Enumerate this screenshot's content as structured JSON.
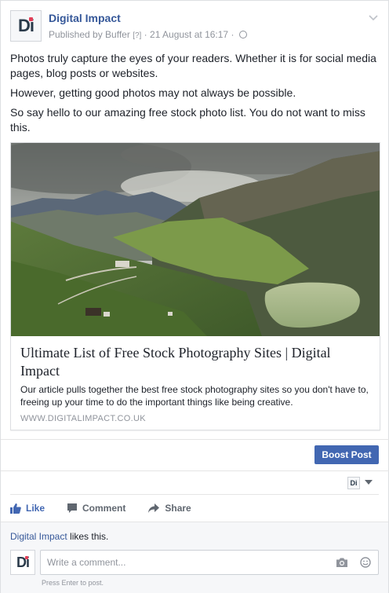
{
  "post": {
    "page_name": "Digital Impact",
    "published_by": "Published by Buffer",
    "help_marker": "[?]",
    "separator": "·",
    "timestamp": "21 August at 16:17",
    "separator2": "·",
    "avatar_text": "Di",
    "paragraphs": [
      "Photos truly capture the eyes of your readers. Whether it is for social media pages, blog posts or websites.",
      "However, getting good photos may not always be possible.",
      "So say hello to our amazing free stock photo list. You do not want to miss this."
    ]
  },
  "link_preview": {
    "title": "Ultimate List of Free Stock Photography Sites | Digital Impact",
    "description": "Our article pulls together the best free stock photography sites so you don't have to, freeing up your time to do the important things like being creative.",
    "domain": "WWW.DIGITALIMPACT.CO.UK",
    "image": "mountain-lake-landscape"
  },
  "boost_label": "Boost Post",
  "mini_avatar_text": "Di",
  "actions": {
    "like": "Like",
    "comment": "Comment",
    "share": "Share"
  },
  "likes": {
    "name": "Digital Impact",
    "suffix": " likes this."
  },
  "comment": {
    "avatar_text": "Di",
    "placeholder": "Write a comment...",
    "hint": "Press Enter to post."
  },
  "colors": {
    "link_blue": "#365899",
    "button_blue": "#4267b2",
    "muted": "#90949c"
  }
}
